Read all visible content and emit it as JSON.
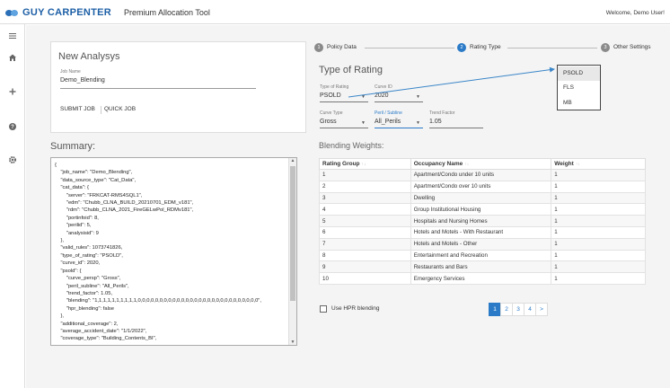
{
  "header": {
    "logo": "GUY CARPENTER",
    "app_title": "Premium Allocation Tool",
    "welcome": "Welcome, Demo User!"
  },
  "sidebar": {
    "icons": [
      "menu-icon",
      "home-icon",
      "plus-icon",
      "help-icon",
      "gear-icon"
    ]
  },
  "new_analysis": {
    "title": "New Analysys",
    "job_name_label": "Job Name",
    "job_name_value": "Demo_Blending",
    "submit_label": "SUBMIT JOB",
    "quick_label": "QUICK JOB"
  },
  "summary": {
    "title": "Summary:",
    "json_text": "{\n    \"job_name\": \"Demo_Blending\",\n    \"data_source_type\": \"Cat_Data\",\n    \"cat_data\": {\n        \"server\": \"FRKCAT-RMS4SQL1\",\n        \"edm\": \"Chubb_CLNA_BUILD_20210701_EDM_v181\",\n        \"rdm\": \"Chubb_CLNA_2021_FireGELwPol_RDMv181\",\n        \"portinfoid\": 8,\n        \"perilid\": 5,\n        \"analysisid\": 9\n    },\n    \"valid_rules\": 1073741826,\n    \"type_of_rating\": \"PSOLD\",\n    \"curve_id\": 2020,\n    \"psold\": {\n        \"curve_persp\": \"Gross\",\n        \"peril_subline\": \"All_Perils\",\n        \"trend_factor\": 1.05,\n        \"blending\": \"1,1,1,1,1,1,1,1,1,1,0,0,0,0,0,0,0,0,0,0,0,0,0,0,0,0,0,0,0,0,0,0,0,0,0,0,0,0\",\n        \"hpr_blending\": false\n    },\n    \"additional_coverage\": 2,\n    \"average_accident_date\": \"1/1/2022\",\n    \"coverage_type\": \"Building_Contents_BI\","
  },
  "stepper": {
    "steps": [
      {
        "num": "1",
        "label": "Policy Data"
      },
      {
        "num": "2",
        "label": "Rating Type"
      },
      {
        "num": "3",
        "label": "Other Settings"
      }
    ]
  },
  "rating": {
    "title": "Type of Rating",
    "type_label": "Type of Rating",
    "type_value": "PSOLD",
    "curve_label": "Curve ID",
    "curve_value": "2020",
    "curve_type_label": "Curve Type",
    "curve_type_value": "Gross",
    "peril_label": "Peril / Subline",
    "peril_value": "All_Perils",
    "trend_label": "Trend Factor",
    "trend_value": "1.05"
  },
  "dropdown_popup": {
    "options": [
      "PSOLD",
      "FLS",
      "MB"
    ]
  },
  "blending": {
    "title": "Blending Weights:",
    "headers": [
      "Rating Group",
      "Occupancy Name",
      "Weight"
    ],
    "rows": [
      [
        "1",
        "Apartment/Condo under 10 units",
        "1"
      ],
      [
        "2",
        "Apartment/Condo over 10 units",
        "1"
      ],
      [
        "3",
        "Dwelling",
        "1"
      ],
      [
        "4",
        "Group Institutional Housing",
        "1"
      ],
      [
        "5",
        "Hospitals and Nursing Homes",
        "1"
      ],
      [
        "6",
        "Hotels and Motels - With Restaurant",
        "1"
      ],
      [
        "7",
        "Hotels and Motels - Other",
        "1"
      ],
      [
        "8",
        "Entertainment and Recreation",
        "1"
      ],
      [
        "9",
        "Restaurants and Bars",
        "1"
      ],
      [
        "10",
        "Emergency Services",
        "1"
      ]
    ],
    "hpr_label": "Use HPR blending",
    "pages": [
      "1",
      "2",
      "3",
      "4",
      ">"
    ]
  },
  "colors": {
    "brand_blue": "#1d5fa6",
    "accent_blue": "#2a7ac7",
    "step_inactive": "#8a8a8a"
  }
}
